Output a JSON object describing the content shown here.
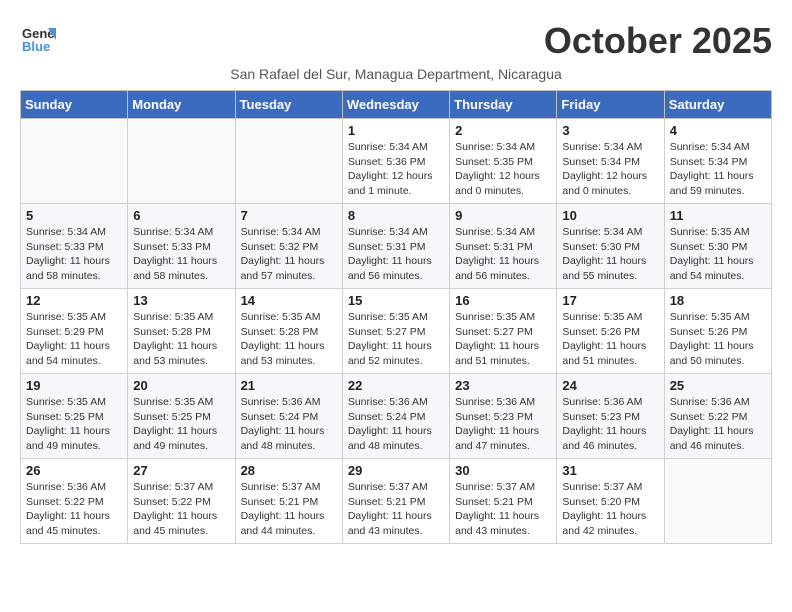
{
  "logo": {
    "line1": "General",
    "line2": "Blue"
  },
  "title": "October 2025",
  "subtitle": "San Rafael del Sur, Managua Department, Nicaragua",
  "days_of_week": [
    "Sunday",
    "Monday",
    "Tuesday",
    "Wednesday",
    "Thursday",
    "Friday",
    "Saturday"
  ],
  "weeks": [
    [
      {
        "day": "",
        "info": ""
      },
      {
        "day": "",
        "info": ""
      },
      {
        "day": "",
        "info": ""
      },
      {
        "day": "1",
        "info": "Sunrise: 5:34 AM\nSunset: 5:36 PM\nDaylight: 12 hours\nand 1 minute."
      },
      {
        "day": "2",
        "info": "Sunrise: 5:34 AM\nSunset: 5:35 PM\nDaylight: 12 hours\nand 0 minutes."
      },
      {
        "day": "3",
        "info": "Sunrise: 5:34 AM\nSunset: 5:34 PM\nDaylight: 12 hours\nand 0 minutes."
      },
      {
        "day": "4",
        "info": "Sunrise: 5:34 AM\nSunset: 5:34 PM\nDaylight: 11 hours\nand 59 minutes."
      }
    ],
    [
      {
        "day": "5",
        "info": "Sunrise: 5:34 AM\nSunset: 5:33 PM\nDaylight: 11 hours\nand 58 minutes."
      },
      {
        "day": "6",
        "info": "Sunrise: 5:34 AM\nSunset: 5:33 PM\nDaylight: 11 hours\nand 58 minutes."
      },
      {
        "day": "7",
        "info": "Sunrise: 5:34 AM\nSunset: 5:32 PM\nDaylight: 11 hours\nand 57 minutes."
      },
      {
        "day": "8",
        "info": "Sunrise: 5:34 AM\nSunset: 5:31 PM\nDaylight: 11 hours\nand 56 minutes."
      },
      {
        "day": "9",
        "info": "Sunrise: 5:34 AM\nSunset: 5:31 PM\nDaylight: 11 hours\nand 56 minutes."
      },
      {
        "day": "10",
        "info": "Sunrise: 5:34 AM\nSunset: 5:30 PM\nDaylight: 11 hours\nand 55 minutes."
      },
      {
        "day": "11",
        "info": "Sunrise: 5:35 AM\nSunset: 5:30 PM\nDaylight: 11 hours\nand 54 minutes."
      }
    ],
    [
      {
        "day": "12",
        "info": "Sunrise: 5:35 AM\nSunset: 5:29 PM\nDaylight: 11 hours\nand 54 minutes."
      },
      {
        "day": "13",
        "info": "Sunrise: 5:35 AM\nSunset: 5:28 PM\nDaylight: 11 hours\nand 53 minutes."
      },
      {
        "day": "14",
        "info": "Sunrise: 5:35 AM\nSunset: 5:28 PM\nDaylight: 11 hours\nand 53 minutes."
      },
      {
        "day": "15",
        "info": "Sunrise: 5:35 AM\nSunset: 5:27 PM\nDaylight: 11 hours\nand 52 minutes."
      },
      {
        "day": "16",
        "info": "Sunrise: 5:35 AM\nSunset: 5:27 PM\nDaylight: 11 hours\nand 51 minutes."
      },
      {
        "day": "17",
        "info": "Sunrise: 5:35 AM\nSunset: 5:26 PM\nDaylight: 11 hours\nand 51 minutes."
      },
      {
        "day": "18",
        "info": "Sunrise: 5:35 AM\nSunset: 5:26 PM\nDaylight: 11 hours\nand 50 minutes."
      }
    ],
    [
      {
        "day": "19",
        "info": "Sunrise: 5:35 AM\nSunset: 5:25 PM\nDaylight: 11 hours\nand 49 minutes."
      },
      {
        "day": "20",
        "info": "Sunrise: 5:35 AM\nSunset: 5:25 PM\nDaylight: 11 hours\nand 49 minutes."
      },
      {
        "day": "21",
        "info": "Sunrise: 5:36 AM\nSunset: 5:24 PM\nDaylight: 11 hours\nand 48 minutes."
      },
      {
        "day": "22",
        "info": "Sunrise: 5:36 AM\nSunset: 5:24 PM\nDaylight: 11 hours\nand 48 minutes."
      },
      {
        "day": "23",
        "info": "Sunrise: 5:36 AM\nSunset: 5:23 PM\nDaylight: 11 hours\nand 47 minutes."
      },
      {
        "day": "24",
        "info": "Sunrise: 5:36 AM\nSunset: 5:23 PM\nDaylight: 11 hours\nand 46 minutes."
      },
      {
        "day": "25",
        "info": "Sunrise: 5:36 AM\nSunset: 5:22 PM\nDaylight: 11 hours\nand 46 minutes."
      }
    ],
    [
      {
        "day": "26",
        "info": "Sunrise: 5:36 AM\nSunset: 5:22 PM\nDaylight: 11 hours\nand 45 minutes."
      },
      {
        "day": "27",
        "info": "Sunrise: 5:37 AM\nSunset: 5:22 PM\nDaylight: 11 hours\nand 45 minutes."
      },
      {
        "day": "28",
        "info": "Sunrise: 5:37 AM\nSunset: 5:21 PM\nDaylight: 11 hours\nand 44 minutes."
      },
      {
        "day": "29",
        "info": "Sunrise: 5:37 AM\nSunset: 5:21 PM\nDaylight: 11 hours\nand 43 minutes."
      },
      {
        "day": "30",
        "info": "Sunrise: 5:37 AM\nSunset: 5:21 PM\nDaylight: 11 hours\nand 43 minutes."
      },
      {
        "day": "31",
        "info": "Sunrise: 5:37 AM\nSunset: 5:20 PM\nDaylight: 11 hours\nand 42 minutes."
      },
      {
        "day": "",
        "info": ""
      }
    ]
  ]
}
